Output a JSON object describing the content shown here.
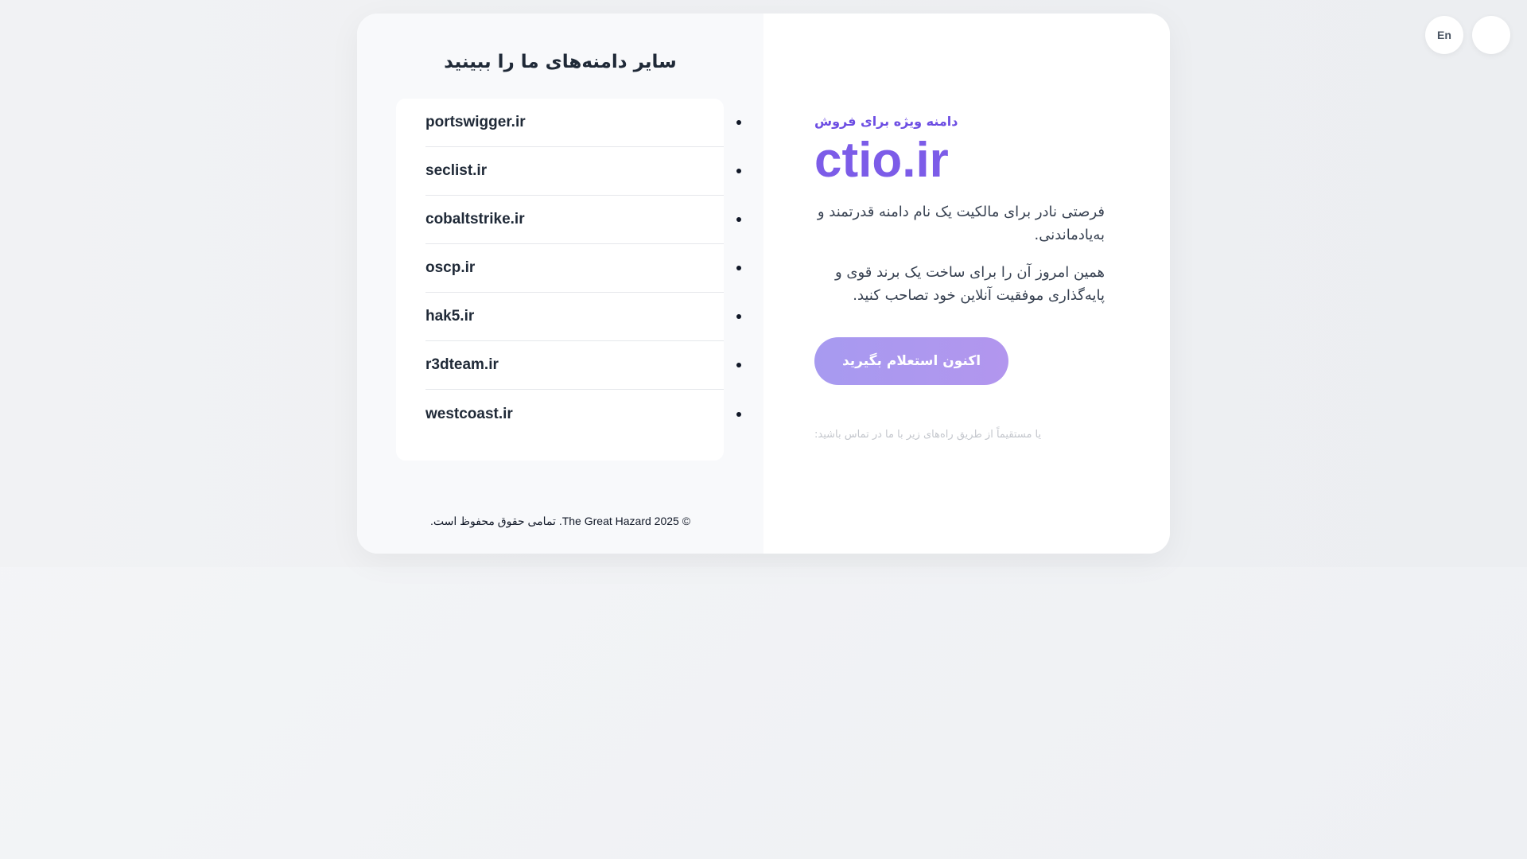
{
  "header": {
    "lang_button": "En",
    "theme_button": ""
  },
  "sidebar": {
    "title": "سایر دامنه‌های ما را ببینید",
    "domains": [
      "portswigger.ir",
      "seclist.ir",
      "cobaltstrike.ir",
      "oscp.ir",
      "hak5.ir",
      "r3dteam.ir",
      "westcoast.ir"
    ],
    "copyright": "© 2025 The Great Hazard. تمامی حقوق محفوظ است."
  },
  "main": {
    "tagline": "دامنه ویژه برای فروش",
    "domain": "ctio.ir",
    "desc1": "فرصتی نادر برای مالکیت یک نام دامنه قدرتمند و به‌یادماندنی.",
    "desc2": "همین امروز آن را برای ساخت یک برند قوی و پایه‌گذاری موفقیت آنلاین خود تصاحب کنید.",
    "cta_label": "اکنون استعلام بگیرید",
    "contact_text": "یا مستقیماً از طریق راه‌های زیر با ما در تماس باشید:"
  },
  "colors": {
    "accent": "#7c5ce8",
    "cta_gradient_start": "#a79af0",
    "cta_gradient_end": "#b296ee"
  }
}
